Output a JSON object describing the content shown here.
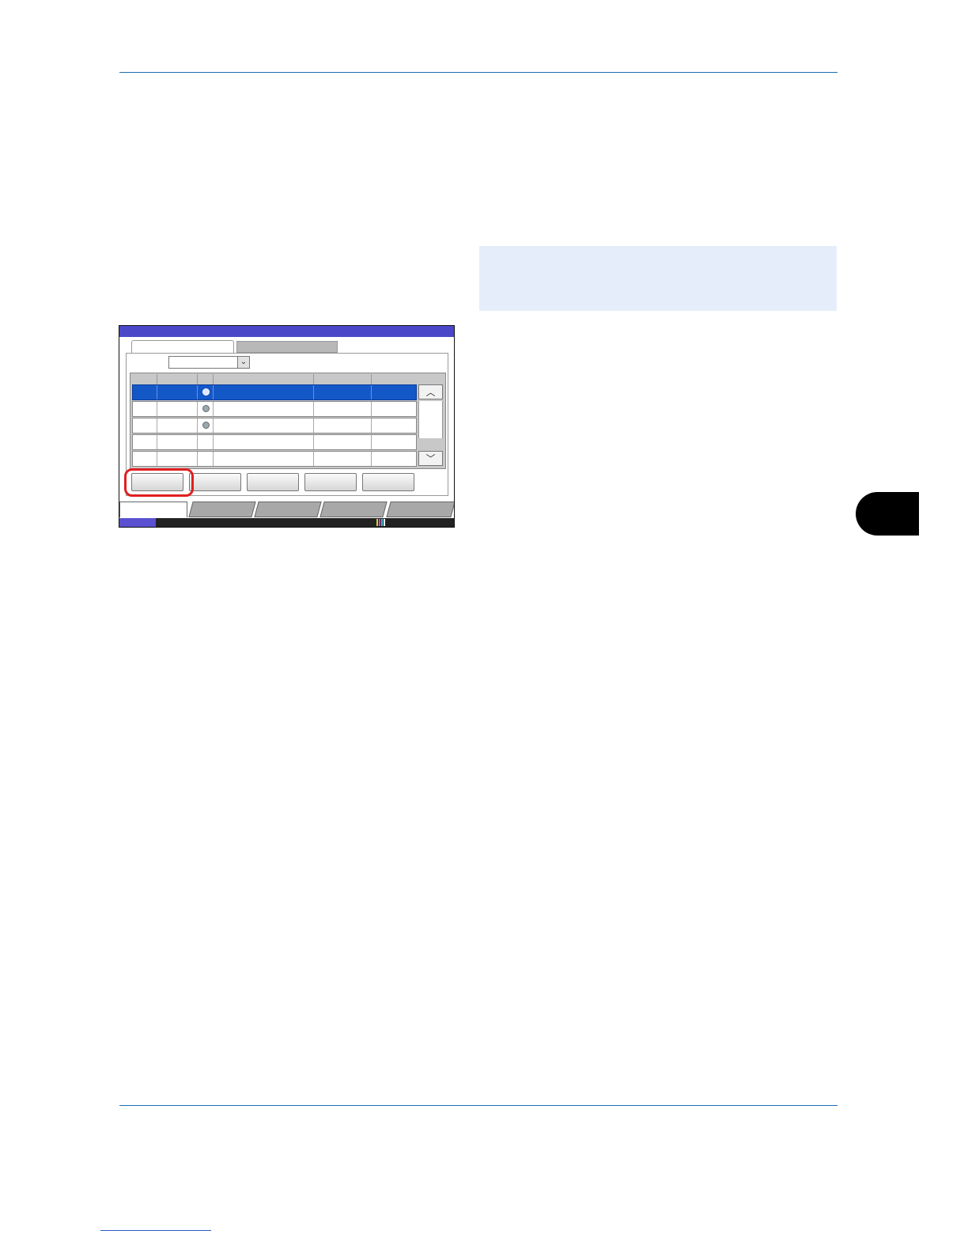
{
  "document": {
    "header_rule_color": "#1a6fb3",
    "note_box_color": "#e6edfa",
    "footer_link_color": "#2a5bc0"
  },
  "screen": {
    "titlebar_color": "#4a48c8",
    "selected_row_color": "#1458c8",
    "highlight_color": "#e02020",
    "dropdown_icon": "double-chevron-down-icon",
    "scroll_up_icon": "chevron-up-icon",
    "scroll_down_icon": "chevron-down-icon",
    "scroll_up_glyph": "︿",
    "scroll_down_glyph": "﹀",
    "dropdown_glyph": "⌄",
    "rows": [
      {
        "selected": true,
        "has_icon": true
      },
      {
        "selected": false,
        "has_icon": true
      },
      {
        "selected": false,
        "has_icon": true
      },
      {
        "selected": false,
        "has_icon": false
      },
      {
        "selected": false,
        "has_icon": false
      }
    ],
    "action_buttons": 5,
    "bottom_tabs": 5
  }
}
